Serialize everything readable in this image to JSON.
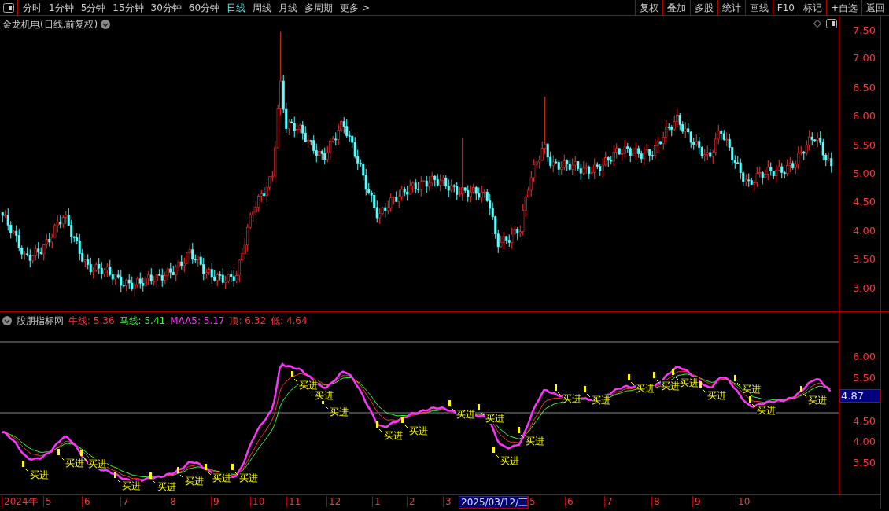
{
  "toolbar": {
    "periods": [
      {
        "label": "分时",
        "selected": false
      },
      {
        "label": "1分钟",
        "selected": false
      },
      {
        "label": "5分钟",
        "selected": false
      },
      {
        "label": "15分钟",
        "selected": false
      },
      {
        "label": "30分钟",
        "selected": false
      },
      {
        "label": "60分钟",
        "selected": false
      },
      {
        "label": "日线",
        "selected": true
      },
      {
        "label": "周线",
        "selected": false
      },
      {
        "label": "月线",
        "selected": false
      },
      {
        "label": "多周期",
        "selected": false
      },
      {
        "label": "更多 >",
        "selected": false
      }
    ],
    "buttons": [
      "复权",
      "叠加",
      "多股",
      "统计",
      "画线",
      "F10",
      "标记",
      "+自选",
      "返回"
    ]
  },
  "main_chart": {
    "title": "金龙机电(日线.前复权)",
    "price_ticks": [
      "7.50",
      "7.00",
      "6.50",
      "6.00",
      "5.50",
      "5.00",
      "4.50",
      "4.00",
      "3.50",
      "3.00"
    ]
  },
  "indicator": {
    "name": "股朋指标网",
    "legend": [
      {
        "label": "牛线: 5.36",
        "color": "#ff3232"
      },
      {
        "label": "马线: 5.41",
        "color": "#32ff32"
      },
      {
        "label": "MAA5: 5.17",
        "color": "#ff32ff"
      },
      {
        "label": "顶: 6.32",
        "color": "#ff3232"
      },
      {
        "label": "低: 4.64",
        "color": "#ff3232"
      }
    ],
    "ticks": [
      "6.00",
      "5.50",
      "4.50",
      "4.00",
      "3.50"
    ],
    "current_value": "4.87",
    "signals": [
      "买进",
      "买进",
      "买进",
      "买进",
      "买进",
      "买进",
      "买进",
      "买进",
      "买进",
      "买进",
      "买进",
      "买进",
      "买进",
      "买进",
      "买进",
      "买进",
      "买进",
      "买进",
      "买进",
      "买进",
      "买进",
      "买进",
      "买进",
      "买进",
      "买进",
      "买进"
    ]
  },
  "date_axis": [
    {
      "label": "2024年",
      "selected": false
    },
    {
      "label": "5",
      "selected": false
    },
    {
      "label": "6",
      "selected": false
    },
    {
      "label": "7",
      "selected": false
    },
    {
      "label": "8",
      "selected": false
    },
    {
      "label": "9",
      "selected": false
    },
    {
      "label": "10",
      "selected": false
    },
    {
      "label": "11",
      "selected": false
    },
    {
      "label": "12",
      "selected": false
    },
    {
      "label": "1",
      "selected": false
    },
    {
      "label": "2",
      "selected": false
    },
    {
      "label": "3",
      "selected": false
    },
    {
      "label": "2025/03/12/三",
      "selected": true
    },
    {
      "label": "5",
      "selected": false
    },
    {
      "label": "6",
      "selected": false
    },
    {
      "label": "7",
      "selected": false
    },
    {
      "label": "8",
      "selected": false
    },
    {
      "label": "9",
      "selected": false
    },
    {
      "label": "10",
      "selected": false
    }
  ]
}
